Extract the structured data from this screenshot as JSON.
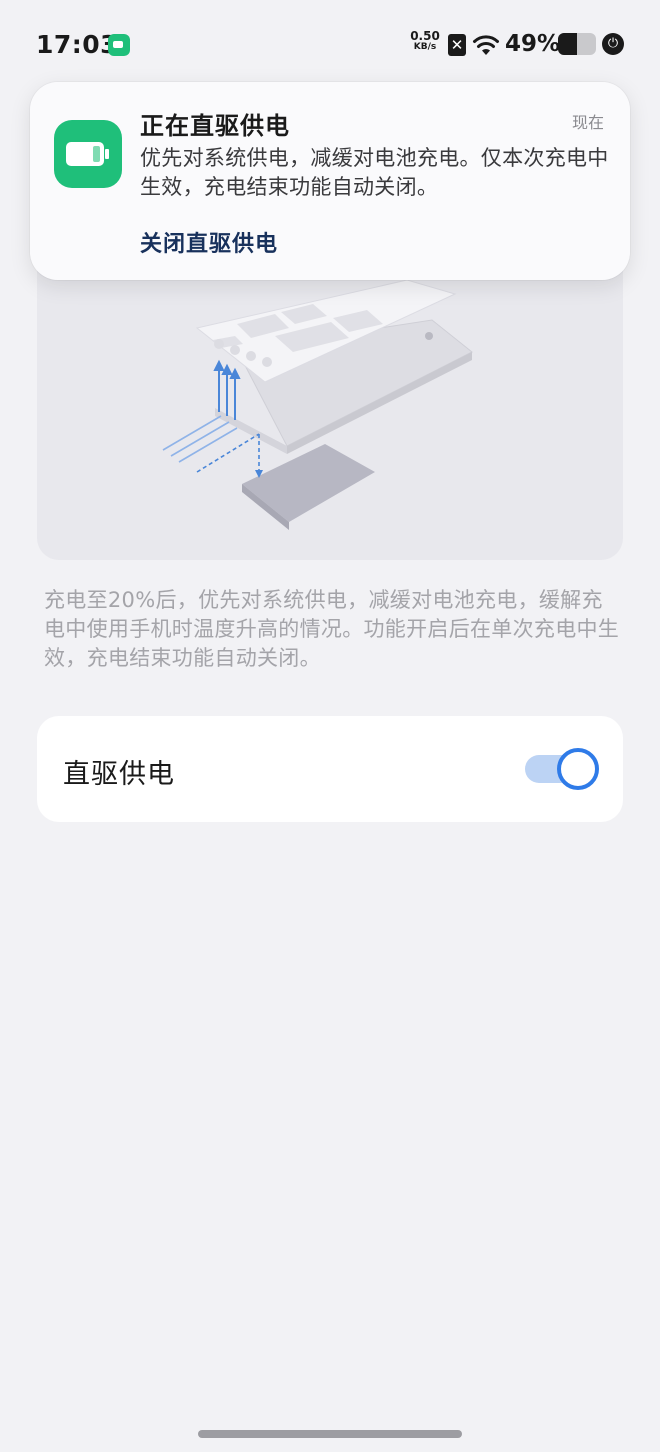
{
  "status_bar": {
    "time": "17:03",
    "network_speed_value": "0.50",
    "network_speed_unit": "KB/s",
    "sim_status_glyph": "✕",
    "battery_percent": "49%",
    "battery_level": 0.49,
    "icons": [
      "app-battery-icon",
      "no-sim-icon",
      "wifi-icon",
      "battery-icon",
      "charging-plug-icon"
    ]
  },
  "notification": {
    "title": "正在直驱供电",
    "time": "现在",
    "body": "优先对系统供电，减缓对电池充电。仅本次充电中生效，充电结束功能自动关闭。",
    "action_label": "关闭直驱供电",
    "app_icon": "battery-app-icon",
    "accent_color": "#1fbf7a",
    "action_color": "#18315c"
  },
  "description": "充电至20%后，优先对系统供电，减缓对电池充电，缓解充电中使用手机时温度升高的情况。功能开启后在单次充电中生效，充电结束功能自动关闭。",
  "setting": {
    "label": "直驱供电",
    "enabled": true,
    "switch_color": "#2f7be8"
  }
}
